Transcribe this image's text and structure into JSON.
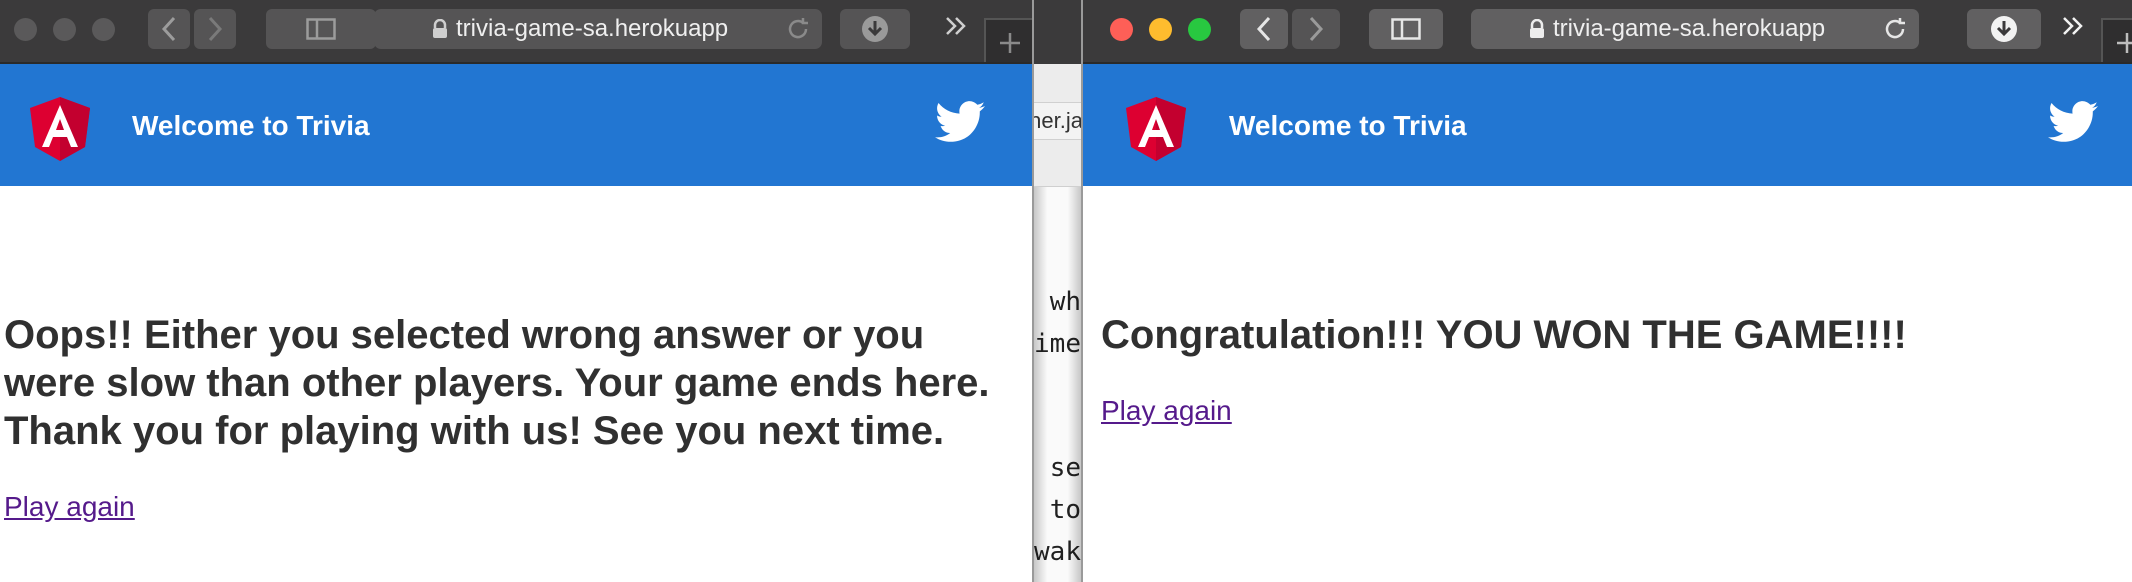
{
  "left_window": {
    "url": "trivia-game-sa.herokuapp",
    "header_title": "Welcome to Trivia",
    "message_lines": [
      "Oops!! Either you selected wrong answer or you",
      "were slow than other players. Your game ends here.",
      "Thank you for playing with us! See you next time."
    ],
    "play_again": "Play again"
  },
  "right_window": {
    "url": "trivia-game-sa.herokuapp",
    "header_title": "Welcome to Trivia",
    "message": "Congratulation!!! YOU WON THE GAME!!!!",
    "play_again": "Play again"
  },
  "background_window": {
    "tab_fragment": "her.ja",
    "code_fragments": [
      "wh",
      "ime",
      "se",
      "to",
      "wak"
    ]
  },
  "icons": {
    "back": "chevron-left-icon",
    "forward": "chevron-right-icon",
    "sidebar": "sidebar-icon",
    "lock": "lock-icon",
    "reload": "reload-icon",
    "download": "download-icon",
    "more": "double-chevron-icon",
    "new_tab": "plus-icon",
    "brand": "angular-logo-icon",
    "social": "twitter-icon"
  },
  "colors": {
    "navbar": "#2276d2",
    "toolbar": "#3b3a3b",
    "link_visited": "#551a8b",
    "text": "#303030",
    "angular_red": "#dd0031"
  }
}
